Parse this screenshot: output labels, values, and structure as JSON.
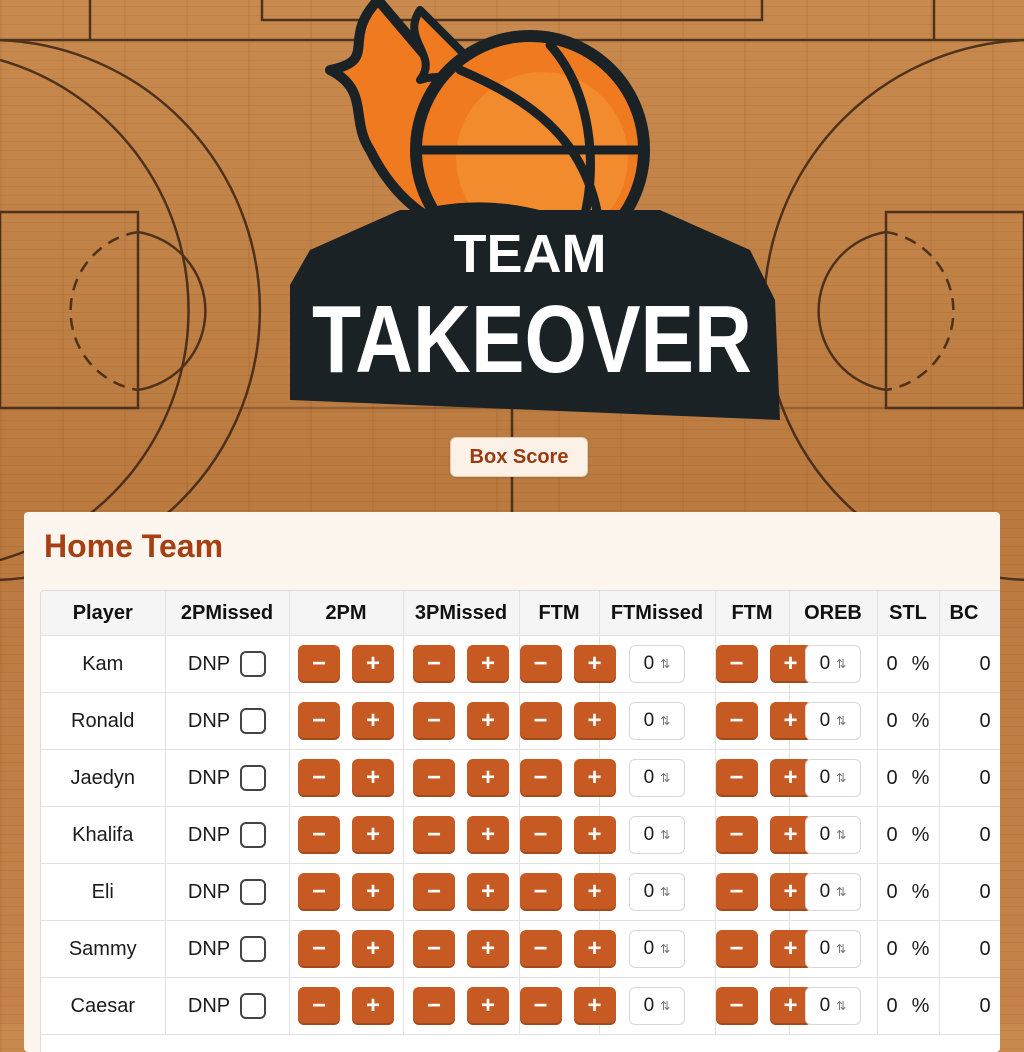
{
  "logo": {
    "line1": "TEAM",
    "line2": "TAKEOVER",
    "icon": "flaming-basketball-icon"
  },
  "box_score_label": "Box Score",
  "panel": {
    "title": "Home Team"
  },
  "columns": [
    "Player",
    "2PMissed",
    "2PM",
    "3PMissed",
    "FTM",
    "FTMissed",
    "FTM",
    "OREB",
    "STL",
    "BC"
  ],
  "dnp_label": "DNP",
  "minus_symbol": "−",
  "plus_symbol": "+",
  "stepper_value": "0",
  "percent_symbol": "%",
  "rows": [
    {
      "player": "Kam",
      "oreb": "0",
      "stl": "0",
      "blk": "0"
    },
    {
      "player": "Ronald",
      "oreb": "0",
      "stl": "0",
      "blk": "0"
    },
    {
      "player": "Jaedyn",
      "oreb": "0",
      "stl": "0",
      "blk": "0"
    },
    {
      "player": "Khalifa",
      "oreb": "0",
      "stl": "0",
      "blk": "0"
    },
    {
      "player": "Eli",
      "oreb": "0",
      "stl": "0",
      "blk": "0"
    },
    {
      "player": "Sammy",
      "oreb": "0",
      "stl": "0",
      "blk": "0"
    },
    {
      "player": "Caesar",
      "oreb": "0",
      "stl": "0",
      "blk": "0"
    }
  ],
  "colors": {
    "accent": "#c75a22",
    "title": "#a63f13",
    "panel": "#fdf6ee"
  }
}
